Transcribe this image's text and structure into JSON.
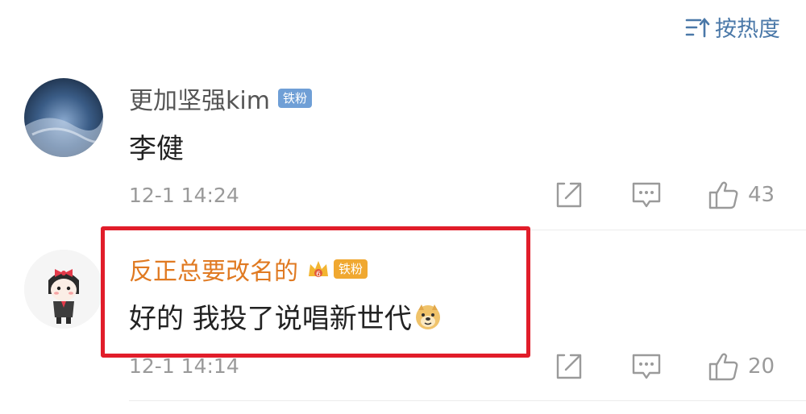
{
  "sort": {
    "label": "按热度",
    "icon": "sort-icon"
  },
  "comments": [
    {
      "username": "更加坚强kim",
      "username_color": "#555555",
      "badge": "铁粉",
      "badge_color": "#6f9fd6",
      "text": "李健",
      "time": "12-1 14:24",
      "likes": "43"
    },
    {
      "username": "反正总要改名的",
      "username_color": "#e07a22",
      "badge": "铁粉",
      "badge_level": "6",
      "badge_color": "#f0a830",
      "text": "好的 我投了说唱新世代",
      "emoji": "doge-emoji",
      "time": "12-1 14:14",
      "likes": "20"
    }
  ],
  "highlight_color": "#e11d2a"
}
